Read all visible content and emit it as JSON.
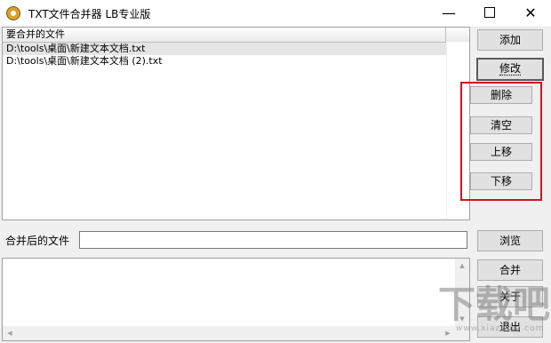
{
  "window": {
    "title": "TXT文件合并器 LB专业版",
    "minimize_glyph": "—",
    "close_glyph": "✕"
  },
  "file_list": {
    "column_header": "要合并的文件",
    "rows": [
      "D:\\tools\\桌面\\新建文本文档.txt",
      "D:\\tools\\桌面\\新建文本文档 (2).txt"
    ]
  },
  "buttons": {
    "add": "添加",
    "modify": "修改",
    "delete": "删除",
    "clear": "清空",
    "move_up": "上移",
    "move_down": "下移",
    "browse": "浏览",
    "merge": "合并",
    "about": "关于",
    "exit": "退出"
  },
  "output": {
    "label": "合并后的文件",
    "value": ""
  },
  "colors": {
    "highlight_border": "#c8181e"
  }
}
